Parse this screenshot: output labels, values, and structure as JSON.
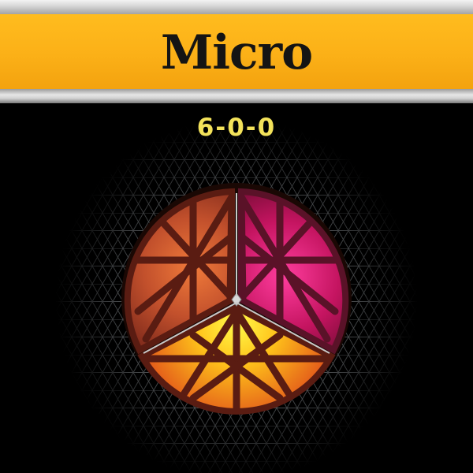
{
  "label": {
    "title": "Micro",
    "npk": "6-0-0"
  },
  "colors": {
    "band_yellow": "#fbb017",
    "formula_yellow": "#f3e25a",
    "background": "#000000",
    "segment_left": "#b8442a",
    "segment_right": "#b5124c",
    "segment_bottom": "#ffd21f",
    "frame": "#5a1c12"
  },
  "emblem": {
    "icon": "tri-segment-crystal-emblem-icon",
    "background_icon": "triangular-grid-icon"
  }
}
